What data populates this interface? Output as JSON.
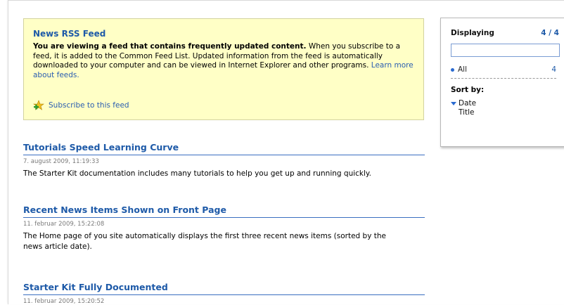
{
  "feed": {
    "title": "News RSS Feed",
    "notice_bold": "You are viewing a feed that contains frequently updated content.",
    "notice_text": " When you subscribe to a feed, it is added to the Common Feed List. Updated information from the feed is automatically downloaded to your computer and can be viewed in Internet Explorer and other programs. ",
    "learn_more": "Learn more about feeds.",
    "subscribe_label": "Subscribe to this feed"
  },
  "articles": [
    {
      "title": "Tutorials Speed Learning Curve",
      "date": "7. august 2009, 11:19:33",
      "body": "The Starter Kit documentation includes many tutorials to help you get up and running quickly."
    },
    {
      "title": "Recent News Items Shown on Front Page",
      "date": "11. februar 2009, 15:22:08",
      "body": "The Home page of you site automatically displays the first three recent news items (sorted by the news article date)."
    },
    {
      "title": "Starter Kit Fully Documented",
      "date": "11. februar 2009, 15:20:52",
      "body": ""
    }
  ],
  "sidebar": {
    "displaying_label": "Displaying",
    "displaying_count": "4 / 4",
    "filter_placeholder": "",
    "all_label": "All",
    "all_count": "4",
    "sort_label": "Sort by:",
    "sort_options": [
      "Date",
      "Title"
    ],
    "selected_sort": "Date"
  },
  "colors": {
    "link_blue": "#1e5aa8",
    "feed_box_bg": "#ffffc6"
  },
  "icons": {
    "subscribe": "subscribe-star-plus-icon",
    "sort_selected": "triangle-down-icon",
    "filter_bullet": "bullet-icon"
  }
}
